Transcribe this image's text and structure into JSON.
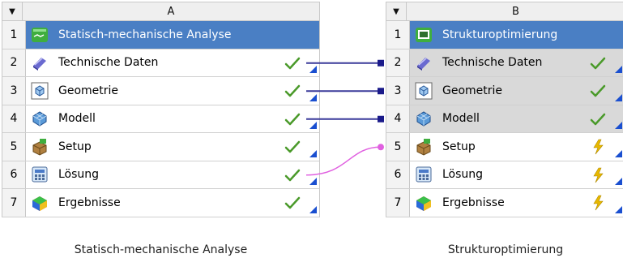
{
  "systems": [
    {
      "column_letter": "A",
      "caption": "Statisch-mechanische Analyse",
      "rows": [
        {
          "num": "1",
          "label": "Statisch-mechanische Analyse",
          "status": "",
          "icon": "static-structural-icon"
        },
        {
          "num": "2",
          "label": "Technische Daten",
          "status": "check",
          "icon": "engineering-data-icon"
        },
        {
          "num": "3",
          "label": "Geometrie",
          "status": "check",
          "icon": "geometry-icon"
        },
        {
          "num": "4",
          "label": "Modell",
          "status": "check",
          "icon": "model-icon"
        },
        {
          "num": "5",
          "label": "Setup",
          "status": "check",
          "icon": "setup-icon"
        },
        {
          "num": "6",
          "label": "Lösung",
          "status": "check",
          "icon": "solution-icon"
        },
        {
          "num": "7",
          "label": "Ergebnisse",
          "status": "check",
          "icon": "results-icon"
        }
      ]
    },
    {
      "column_letter": "B",
      "caption": "Strukturoptimierung",
      "rows": [
        {
          "num": "1",
          "label": "Strukturoptimierung",
          "status": "",
          "icon": "topology-optimization-icon"
        },
        {
          "num": "2",
          "label": "Technische Daten",
          "status": "check",
          "icon": "engineering-data-icon"
        },
        {
          "num": "3",
          "label": "Geometrie",
          "status": "check",
          "icon": "geometry-icon"
        },
        {
          "num": "4",
          "label": "Modell",
          "status": "check",
          "icon": "model-icon"
        },
        {
          "num": "5",
          "label": "Setup",
          "status": "refresh",
          "icon": "setup-icon"
        },
        {
          "num": "6",
          "label": "Lösung",
          "status": "refresh",
          "icon": "solution-icon"
        },
        {
          "num": "7",
          "label": "Ergebnisse",
          "status": "refresh",
          "icon": "results-icon"
        }
      ]
    }
  ],
  "colors": {
    "title_bar": "#4a7fc4",
    "shared_cell": "#d9d9d9",
    "link_line": "#3a3a9a",
    "transfer_line": "#e060e0",
    "check": "#4a9a2a",
    "refresh": "#e8b800",
    "corner": "#1a4fd0"
  }
}
